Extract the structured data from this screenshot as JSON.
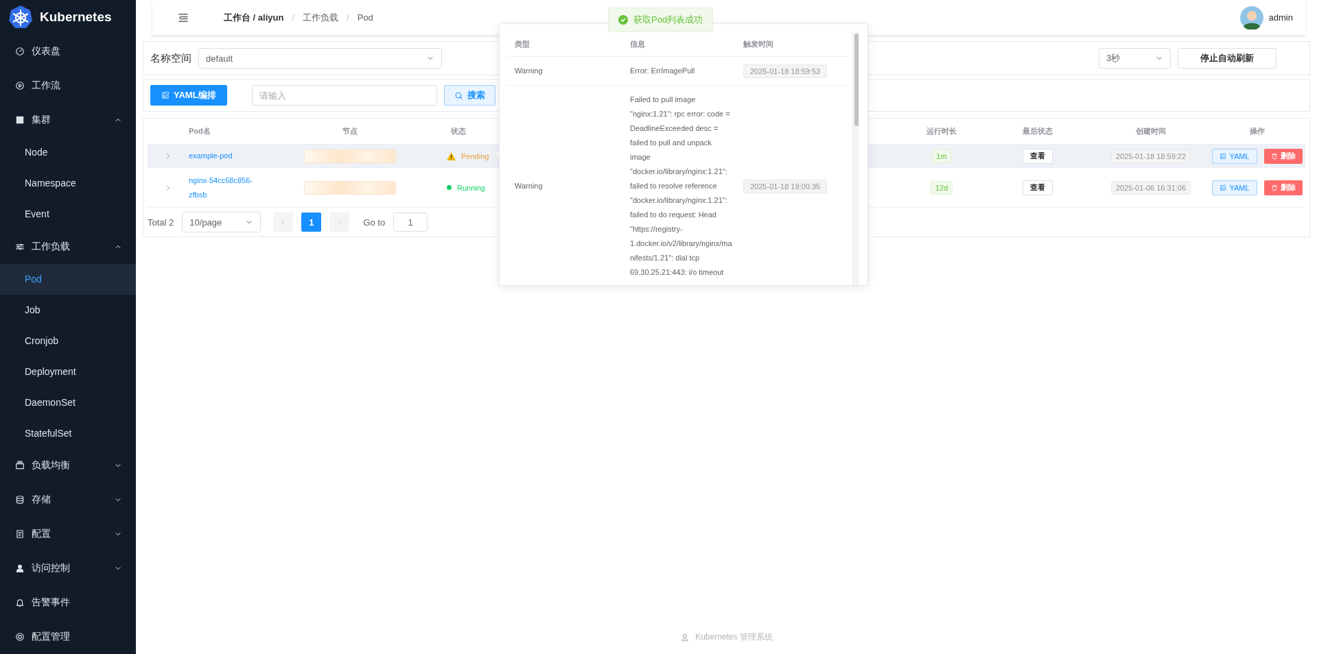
{
  "brand": {
    "title": "Kubernetes"
  },
  "sidebar": {
    "items": [
      {
        "label": "仪表盘",
        "kind": "link",
        "selected": false
      },
      {
        "label": "工作流",
        "kind": "link",
        "selected": false
      },
      {
        "label": "集群",
        "kind": "group",
        "expanded": true,
        "children": [
          {
            "label": "Node",
            "selected": false
          },
          {
            "label": "Namespace",
            "selected": false
          },
          {
            "label": "Event",
            "selected": false
          }
        ]
      },
      {
        "label": "工作负载",
        "kind": "group",
        "expanded": true,
        "children": [
          {
            "label": "Pod",
            "selected": true
          },
          {
            "label": "Job",
            "selected": false
          },
          {
            "label": "Cronjob",
            "selected": false
          },
          {
            "label": "Deployment",
            "selected": false
          },
          {
            "label": "DaemonSet",
            "selected": false
          },
          {
            "label": "StatefulSet",
            "selected": false
          }
        ]
      },
      {
        "label": "负载均衡",
        "kind": "group",
        "expanded": false
      },
      {
        "label": "存储",
        "kind": "group",
        "expanded": false
      },
      {
        "label": "配置",
        "kind": "group",
        "expanded": false
      },
      {
        "label": "访问控制",
        "kind": "group",
        "expanded": false
      },
      {
        "label": "告警事件",
        "kind": "link",
        "selected": false
      },
      {
        "label": "配置管理",
        "kind": "link",
        "selected": false
      }
    ]
  },
  "header": {
    "breadcrumb": [
      {
        "text": "工作台 / aliyun",
        "bold": true
      },
      {
        "text": "工作负载",
        "bold": false
      },
      {
        "text": "Pod",
        "bold": false
      }
    ],
    "separator": "/",
    "user": "admin"
  },
  "namespace": {
    "label": "名称空间",
    "value": "default",
    "interval": "3秒",
    "stop_button": "停止自动刷新"
  },
  "toolbar": {
    "yaml_button": "YAML编排",
    "search_placeholder": "请输入",
    "search_button": "搜索"
  },
  "table": {
    "columns": [
      "Pod名",
      "节点",
      "状态",
      "运行时长",
      "最后状态",
      "创建时间",
      "操作"
    ],
    "rows": [
      {
        "name": "example-pod",
        "status": "Pending",
        "kind": "warning",
        "uptime": "1m",
        "last_state": "查看",
        "created": "2025-01-18 18:59:22",
        "yaml": "YAML",
        "delete": "删除",
        "highlighted": true
      },
      {
        "name": "nginx-54cc68c856-zfbsb",
        "status": "Running",
        "kind": "running",
        "uptime": "12d",
        "last_state": "查看",
        "created": "2025-01-06 16:31:06",
        "yaml": "YAML",
        "delete": "删除",
        "highlighted": false
      }
    ]
  },
  "pagination": {
    "total": "Total 2",
    "page_size": "10/page",
    "pages": [
      {
        "label": "1",
        "selected": true
      }
    ],
    "goto_label": "Go to",
    "goto_value": "1"
  },
  "events_popover": {
    "columns": [
      "类型",
      "信息",
      "触发时间"
    ],
    "rows": [
      {
        "type": "Warning",
        "message": "Error: ErrImagePull",
        "time": "2025-01-18 18:59:53"
      },
      {
        "type": "Warning",
        "message": "Failed to pull image \"nginx:1.21\": rpc error: code = DeadlineExceeded desc = failed to pull and unpack image \"docker.io/library/nginx:1.21\": failed to resolve reference \"docker.io/library/nginx:1.21\": failed to do request: Head \"https://registry-1.docker.io/v2/library/nginx/manifests/1.21\": dial tcp 69.30.25.21:443: i/o timeout",
        "time": "2025-01-18 19:00:35"
      }
    ]
  },
  "toast": {
    "message": "获取Pod列表成功",
    "kind": "success"
  },
  "footer": {
    "text": "Kubernetes 管理系统"
  }
}
